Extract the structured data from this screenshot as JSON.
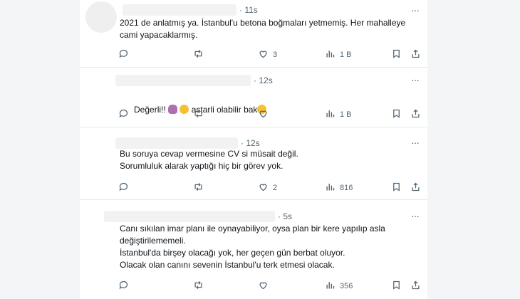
{
  "tweets": [
    {
      "time": "11s",
      "time_prefix": "·",
      "text": "2021 de anlatmış ya. İstanbul'u betona boğmaları yetmemiş. Her mahalleye\ncami yapacaklarmış.",
      "likes": "3",
      "views": "1 B"
    },
    {
      "time": "12s",
      "time_prefix": "·",
      "text_start": "Değerli!! ",
      "text_middle": " astarli olabilir bak",
      "views": "1 B"
    },
    {
      "time": "12s",
      "time_prefix": "·",
      "text": "Bu soruya cevap vermesine CV si müsait değil.\nSorumluluk alarak yaptığı hiç bir görev yok.",
      "likes": "2",
      "views": "816"
    },
    {
      "time": "5s",
      "time_prefix": "·",
      "text": "Canı sıkılan imar planı ile oynayabiliyor, oysa plan bir kere yapılıp asla\ndeğiştirilememeli.\nİstanbul'da birşey olacağı yok, her geçen gün berbat oluyor.\nOlacak olan canını sevenin İstanbul'u terk etmesi olacak.",
      "views": "356"
    }
  ],
  "more_label": "···",
  "icons": {
    "reply": "reply-icon",
    "retweet": "retweet-icon",
    "like": "like-icon",
    "views": "views-icon",
    "bookmark": "bookmark-icon",
    "share": "share-icon"
  },
  "colors": {
    "text": "#0f1419",
    "secondary": "#536471",
    "divider": "#e6e9ec"
  }
}
